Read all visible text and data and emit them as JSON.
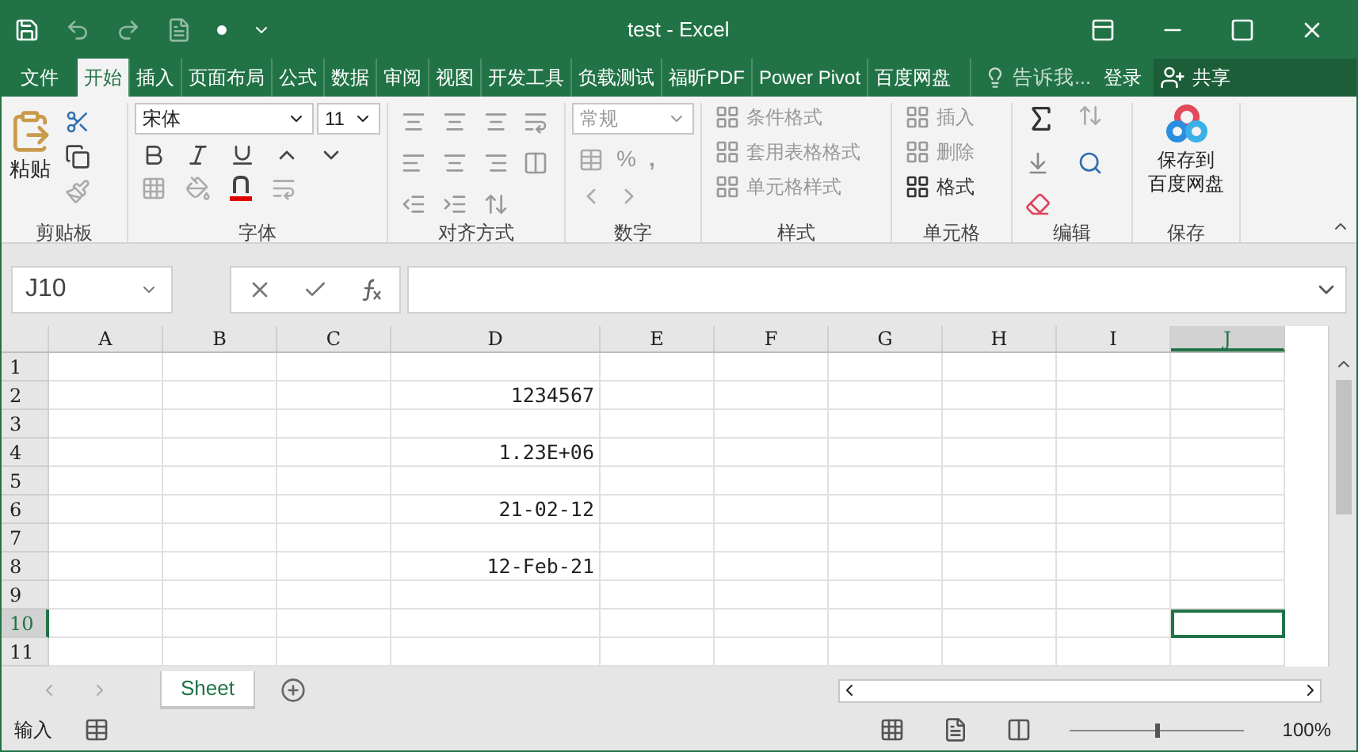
{
  "window": {
    "title": "test - Excel"
  },
  "tabs": [
    {
      "label": "文件",
      "selected": false
    },
    {
      "label": "开始",
      "selected": true
    },
    {
      "label": "插入",
      "selected": false
    },
    {
      "label": "页面布局",
      "selected": false
    },
    {
      "label": "公式",
      "selected": false
    },
    {
      "label": "数据",
      "selected": false
    },
    {
      "label": "审阅",
      "selected": false
    },
    {
      "label": "视图",
      "selected": false
    },
    {
      "label": "开发工具",
      "selected": false
    },
    {
      "label": "负载测试",
      "selected": false
    },
    {
      "label": "福昕PDF",
      "selected": false
    },
    {
      "label": "Power Pivot",
      "selected": false
    },
    {
      "label": "百度网盘",
      "selected": false
    }
  ],
  "tell_me": "告诉我...",
  "login": "登录",
  "share": "共享",
  "ribbon": {
    "paste": "粘贴",
    "font_name": "宋体",
    "font_size": "11",
    "number_format": "常规",
    "percent": "%",
    "comma": ",",
    "styles": [
      "条件格式",
      "套用表格格式",
      "单元格样式"
    ],
    "cells": [
      "插入",
      "删除",
      "格式"
    ],
    "save_lines": [
      "保存到",
      "百度网盘"
    ],
    "groups": [
      "剪贴板",
      "字体",
      "对齐方式",
      "数字",
      "样式",
      "单元格",
      "编辑",
      "保存"
    ]
  },
  "name_box": "J10",
  "columns": [
    {
      "label": "A",
      "selected": false
    },
    {
      "label": "B",
      "selected": false
    },
    {
      "label": "C",
      "selected": false
    },
    {
      "label": "D",
      "selected": false
    },
    {
      "label": "E",
      "selected": false
    },
    {
      "label": "F",
      "selected": false
    },
    {
      "label": "G",
      "selected": false
    },
    {
      "label": "H",
      "selected": false
    },
    {
      "label": "I",
      "selected": false
    },
    {
      "label": "J",
      "selected": true
    }
  ],
  "rows": [
    {
      "header": "1",
      "selected": false,
      "cells": [
        null,
        null,
        null,
        null,
        null,
        null,
        null,
        null,
        null,
        null
      ]
    },
    {
      "header": "2",
      "selected": false,
      "cells": [
        null,
        null,
        null,
        "1234567",
        null,
        null,
        null,
        null,
        null,
        null
      ]
    },
    {
      "header": "3",
      "selected": false,
      "cells": [
        null,
        null,
        null,
        null,
        null,
        null,
        null,
        null,
        null,
        null
      ]
    },
    {
      "header": "4",
      "selected": false,
      "cells": [
        null,
        null,
        null,
        "1.23E+06",
        null,
        null,
        null,
        null,
        null,
        null
      ]
    },
    {
      "header": "5",
      "selected": false,
      "cells": [
        null,
        null,
        null,
        null,
        null,
        null,
        null,
        null,
        null,
        null
      ]
    },
    {
      "header": "6",
      "selected": false,
      "cells": [
        null,
        null,
        null,
        "21-02-12",
        null,
        null,
        null,
        null,
        null,
        null
      ]
    },
    {
      "header": "7",
      "selected": false,
      "cells": [
        null,
        null,
        null,
        null,
        null,
        null,
        null,
        null,
        null,
        null
      ]
    },
    {
      "header": "8",
      "selected": false,
      "cells": [
        null,
        null,
        null,
        "12-Feb-21",
        null,
        null,
        null,
        null,
        null,
        null
      ]
    },
    {
      "header": "9",
      "selected": false,
      "cells": [
        null,
        null,
        null,
        null,
        null,
        null,
        null,
        null,
        null,
        null
      ]
    },
    {
      "header": "10",
      "selected": true,
      "cells": [
        null,
        null,
        null,
        null,
        null,
        null,
        null,
        null,
        null,
        null
      ]
    },
    {
      "header": "11",
      "selected": false,
      "cells": [
        null,
        null,
        null,
        null,
        null,
        null,
        null,
        null,
        null,
        null
      ]
    }
  ],
  "sheets": [
    {
      "label": "Sheet",
      "selected": true
    }
  ],
  "status_bar": {
    "mode": "输入",
    "zoom": "100%",
    "zoom_slider": {
      "level": 0.5
    }
  }
}
